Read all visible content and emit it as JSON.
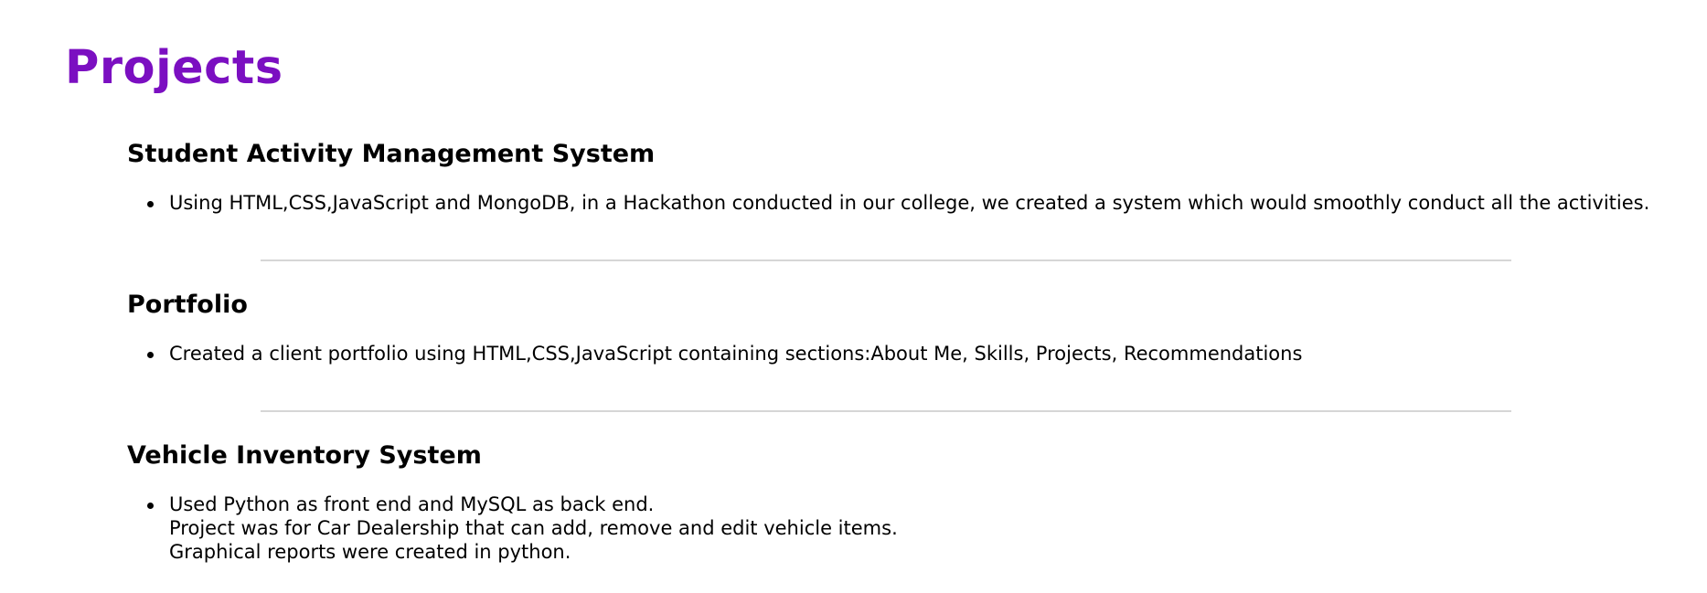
{
  "page": {
    "title": "Projects",
    "accent_color": "#7B0FC1",
    "divider_color": "#d6d6d6"
  },
  "projects": [
    {
      "title": "Student Activity Management System",
      "description_lines": [
        "Using HTML,CSS,JavaScript and MongoDB, in a Hackathon conducted in our college, we created a system which would smoothly conduct all the activities."
      ]
    },
    {
      "title": "Portfolio",
      "description_lines": [
        "Created a client portfolio using HTML,CSS,JavaScript containing sections:About Me, Skills, Projects, Recommendations"
      ]
    },
    {
      "title": "Vehicle Inventory System",
      "description_lines": [
        "Used Python as front end and MySQL as back end.",
        "Project was for Car Dealership that can add, remove and edit vehicle items.",
        "Graphical reports were created in python."
      ]
    }
  ]
}
